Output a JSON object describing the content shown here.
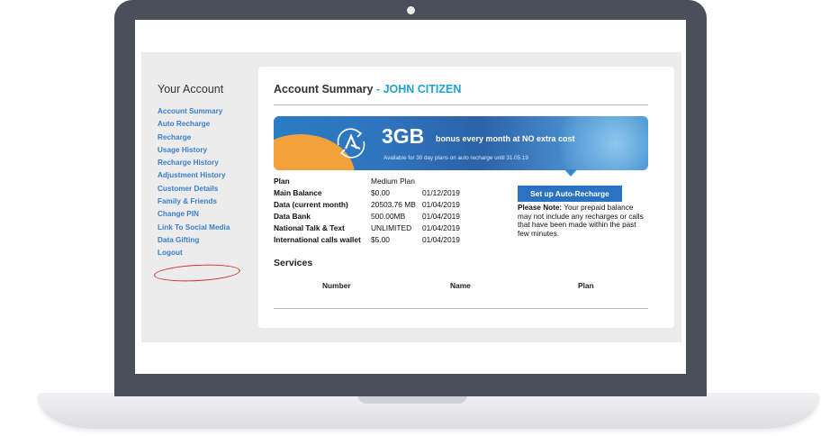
{
  "sidebar": {
    "title": "Your Account",
    "items": [
      {
        "label": "Account Summary"
      },
      {
        "label": "Auto Recharge"
      },
      {
        "label": "Recharge"
      },
      {
        "label": "Usage History"
      },
      {
        "label": "Recharge History"
      },
      {
        "label": "Adjustment History"
      },
      {
        "label": "Customer Details"
      },
      {
        "label": "Family & Friends"
      },
      {
        "label": "Change PIN"
      },
      {
        "label": "Link To Social Media"
      },
      {
        "label": "Data Gifting"
      },
      {
        "label": "Logout"
      }
    ]
  },
  "summary": {
    "title": "Account Summary",
    "separator": " - ",
    "customer_name": "JOHN CITIZEN"
  },
  "banner": {
    "big_text": "3GB",
    "headline": "bonus every month at NO extra cost",
    "subtext": "Available for 30 day plans on auto recharge until 31.05.19"
  },
  "details": [
    {
      "label": "Plan",
      "value": "Medium Plan",
      "date": ""
    },
    {
      "label": "Main Balance",
      "value": "$0.00",
      "date": "01/12/2019"
    },
    {
      "label": "Data (current month)",
      "value": "20503.76 MB",
      "date": "01/04/2019"
    },
    {
      "label": "Data Bank",
      "value": "500.00MB",
      "date": "01/04/2019"
    },
    {
      "label": "National Talk & Text",
      "value": "UNLIMITED",
      "date": "01/04/2019"
    },
    {
      "label": "International calls wallet",
      "value": "$5.00",
      "date": "01/04/2019"
    }
  ],
  "auto_recharge": {
    "button_label": "Set up Auto-Recharge",
    "note_label": "Please Note:",
    "note_text": " Your prepaid balance may not include any recharges or calls that have been made within the past few minutes."
  },
  "services": {
    "title": "Services",
    "columns": [
      "Number",
      "Name",
      "Plan"
    ]
  },
  "colors": {
    "accent": "#1fa3d6",
    "link": "#3a7fcc",
    "button": "#2a73c2",
    "highlight_ring": "#d52a2a"
  }
}
